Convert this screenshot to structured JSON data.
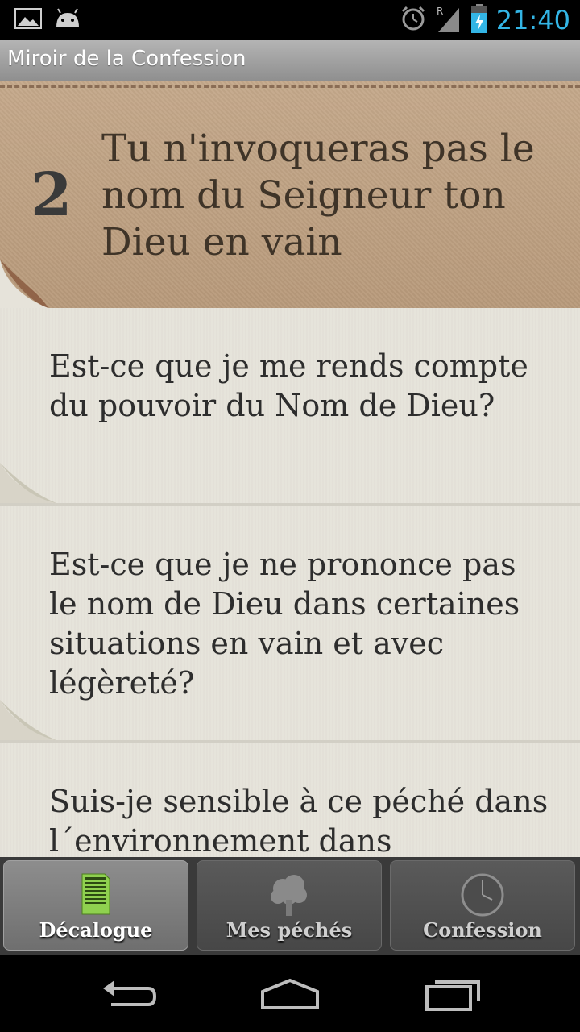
{
  "status": {
    "time": "21:40",
    "left_icons": [
      "image-icon",
      "android-icon"
    ],
    "right_icons": [
      "alarm-icon",
      "signal-icon",
      "battery-icon"
    ],
    "signal_roaming": "R",
    "accent": "#33b5e5"
  },
  "action_bar": {
    "title": "Miroir de la Confession"
  },
  "commandment": {
    "number": "2",
    "title": "Tu n'invoqueras pas le nom du Seigneur ton Dieu en vain"
  },
  "questions": [
    "Est-ce que je me rends compte du pouvoir du Nom de Dieu?",
    "Est-ce que je ne prononce pas le nom de Dieu dans certaines situations en vain et avec légèreté?",
    "Suis-je sensible à ce péché dans l´environnement dans"
  ],
  "tabs": [
    {
      "label": "Décalogue",
      "icon": "decalogue-icon",
      "active": true
    },
    {
      "label": "Mes péchés",
      "icon": "tree-icon",
      "active": false
    },
    {
      "label": "Confession",
      "icon": "clock-icon",
      "active": false
    }
  ],
  "nav": {
    "icons": [
      "back-icon",
      "home-icon",
      "recents-icon"
    ]
  }
}
